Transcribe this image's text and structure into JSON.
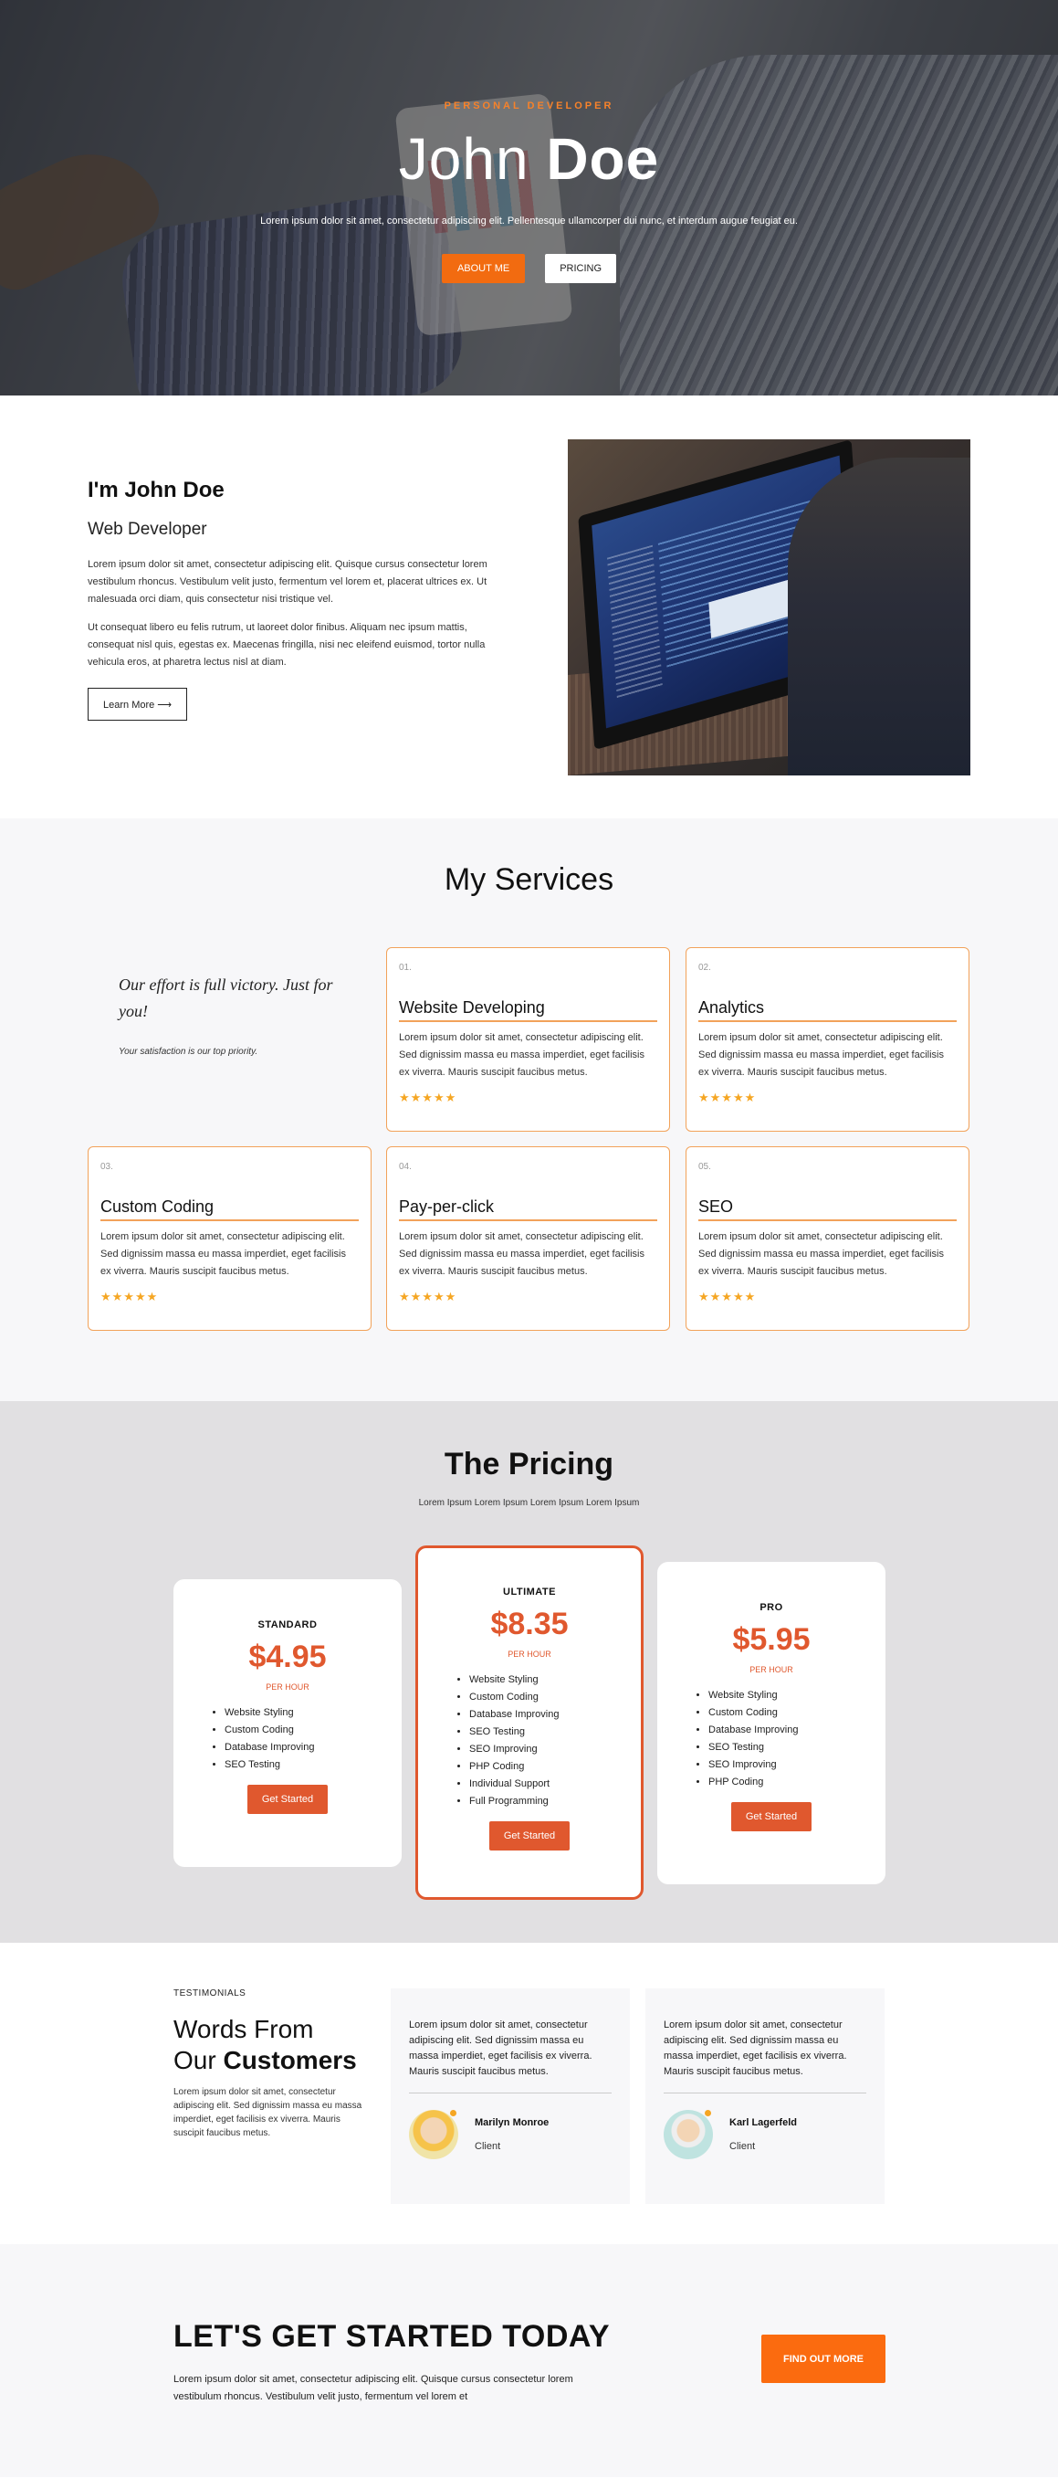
{
  "hero": {
    "kicker": "PERSONAL DEVELOPER",
    "first_name": "John",
    "last_name": "Doe",
    "description": "Lorem ipsum dolor sit amet, consectetur adipiscing elit. Pellentesque ullamcorper dui nunc, et interdum augue feugiat eu.",
    "about_button": "ABOUT ME",
    "pricing_button": "PRICING"
  },
  "about": {
    "title": "I'm John Doe",
    "role": "Web Developer",
    "paragraph1": "Lorem ipsum dolor sit amet, consectetur adipiscing elit. Quisque cursus consectetur lorem vestibulum rhoncus. Vestibulum velit justo, fermentum vel lorem et, placerat ultrices ex. Ut malesuada orci diam, quis consectetur nisi tristique vel.",
    "paragraph2": "Ut consequat libero eu felis rutrum, ut laoreet dolor finibus. Aliquam nec ipsum mattis, consequat nisl quis, egestas ex. Maecenas fringilla, nisi nec eleifend euismod, tortor nulla vehicula eros, at pharetra lectus nisl at diam.",
    "button": "Learn More ⟶"
  },
  "services": {
    "title": "My Services",
    "quote": "Our effort is full victory. Just for you!",
    "subtitle": "Your satisfaction is our top priority.",
    "items": [
      {
        "num": "01.",
        "title": "Website Developing",
        "desc": "Lorem ipsum dolor sit amet, consectetur adipiscing elit. Sed dignissim massa eu massa imperdiet, eget facilisis ex viverra. Mauris suscipit faucibus metus.",
        "stars": "★★★★★"
      },
      {
        "num": "02.",
        "title": "Analytics",
        "desc": "Lorem ipsum dolor sit amet, consectetur adipiscing elit. Sed dignissim massa eu massa imperdiet, eget facilisis ex viverra. Mauris suscipit faucibus metus.",
        "stars": "★★★★★"
      },
      {
        "num": "03.",
        "title": "Custom Coding",
        "desc": "Lorem ipsum dolor sit amet, consectetur adipiscing elit. Sed dignissim massa eu massa imperdiet, eget facilisis ex viverra. Mauris suscipit faucibus metus.",
        "stars": "★★★★★"
      },
      {
        "num": "04.",
        "title": "Pay-per-click",
        "desc": "Lorem ipsum dolor sit amet, consectetur adipiscing elit. Sed dignissim massa eu massa imperdiet, eget facilisis ex viverra. Mauris suscipit faucibus metus.",
        "stars": "★★★★★"
      },
      {
        "num": "05.",
        "title": "SEO",
        "desc": "Lorem ipsum dolor sit amet, consectetur adipiscing elit. Sed dignissim massa eu massa imperdiet, eget facilisis ex viverra. Mauris suscipit faucibus metus.",
        "stars": "★★★★★"
      }
    ]
  },
  "pricing": {
    "title": "The Pricing",
    "subtitle": "Lorem Ipsum Lorem Ipsum Lorem Ipsum Lorem Ipsum",
    "plans": [
      {
        "name": "STANDARD",
        "price": "$4.95",
        "unit": "PER HOUR",
        "features": [
          "Website Styling",
          "Custom Coding",
          "Database Improving",
          "SEO Testing"
        ],
        "button": "Get Started"
      },
      {
        "name": "ULTIMATE",
        "price": "$8.35",
        "unit": "PER HOUR",
        "features": [
          "Website Styling",
          "Custom Coding",
          "Database Improving",
          "SEO Testing",
          "SEO Improving",
          "PHP Coding",
          "Individual Support",
          "Full Programming"
        ],
        "button": "Get Started"
      },
      {
        "name": "PRO",
        "price": "$5.95",
        "unit": "PER HOUR",
        "features": [
          "Website Styling",
          "Custom Coding",
          "Database Improving",
          "SEO Testing",
          "SEO Improving",
          "PHP Coding"
        ],
        "button": "Get Started"
      }
    ]
  },
  "testimonials": {
    "kicker": "TESTIMONIALS",
    "heading_line1": "Words From",
    "heading_line2_prefix": "Our ",
    "heading_line2_bold": "Customers",
    "text": "Lorem ipsum dolor sit amet, consectetur adipiscing elit. Sed dignissim massa eu massa imperdiet, eget facilisis ex viverra. Mauris suscipit faucibus metus.",
    "items": [
      {
        "quote": "Lorem ipsum dolor sit amet, consectetur adipiscing elit. Sed dignissim massa eu massa imperdiet, eget facilisis ex viverra. Mauris suscipit faucibus metus.",
        "name": "Marilyn Monroe",
        "role": "Client"
      },
      {
        "quote": "Lorem ipsum dolor sit amet, consectetur adipiscing elit. Sed dignissim massa eu massa imperdiet, eget facilisis ex viverra. Mauris suscipit faucibus metus.",
        "name": "Karl Lagerfeld",
        "role": "Client"
      }
    ]
  },
  "cta": {
    "title": "LET'S GET STARTED TODAY",
    "text": "Lorem ipsum dolor sit amet, consectetur adipiscing elit. Quisque cursus consectetur lorem vestibulum rhoncus. Vestibulum velit justo, fermentum vel lorem et",
    "button": "FIND OUT MORE"
  },
  "colors": {
    "accent": "#f26b10",
    "price": "#e0582e",
    "card_border": "#f2a25a",
    "star": "#f5a623"
  }
}
